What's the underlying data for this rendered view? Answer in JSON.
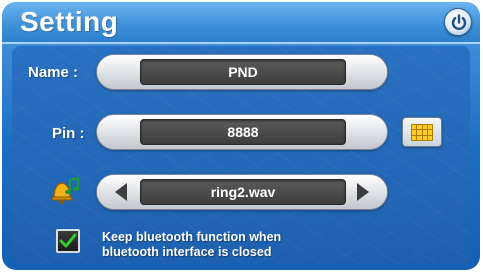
{
  "header": {
    "title": "Setting",
    "power_icon": "power-icon"
  },
  "name": {
    "label": "Name :",
    "value": "PND"
  },
  "pin": {
    "label": "Pin :",
    "value": "8888",
    "keypad_icon": "keypad-icon"
  },
  "ringtone": {
    "icon": "bell-music-icon",
    "value": "ring2.wav",
    "prev_icon": "arrow-left-icon",
    "next_icon": "arrow-right-icon"
  },
  "keep_bluetooth": {
    "checked": true,
    "line1": "Keep bluetooth function when",
    "line2": "bluetooth interface is closed"
  },
  "colors": {
    "panel_blue": "#1b6dc2",
    "header_blue": "#3d8fd8",
    "field_dark": "#3e3e3e",
    "check_green": "#33cc33",
    "keypad_yellow": "#ffcc22"
  }
}
